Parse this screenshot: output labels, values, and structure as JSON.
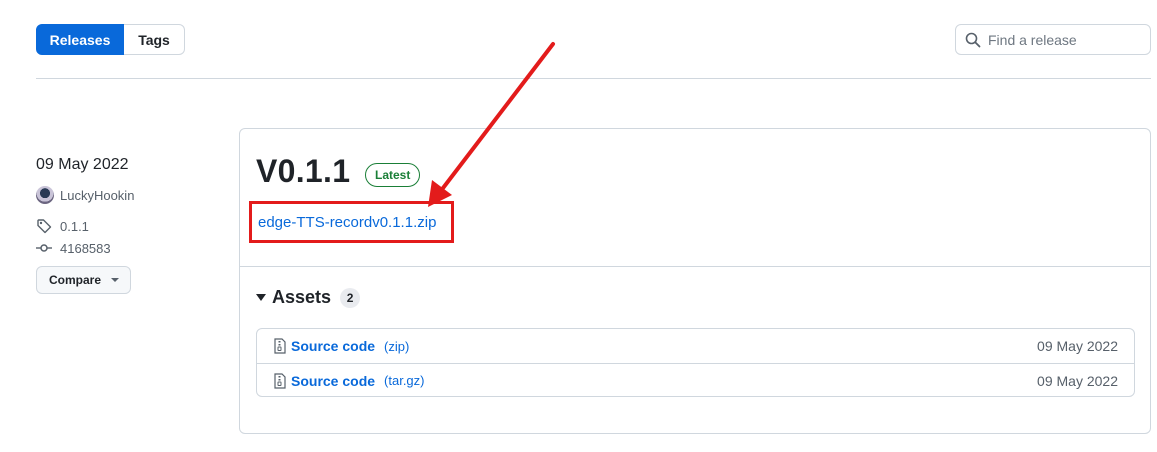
{
  "tabs": [
    {
      "label": "Releases"
    },
    {
      "label": "Tags"
    }
  ],
  "search": {
    "placeholder": "Find a release",
    "icon": "search-icon"
  },
  "meta": {
    "date": "09 May 2022",
    "author": "LuckyHookin",
    "tag": "0.1.1",
    "commit": "4168583",
    "compare_label": "Compare"
  },
  "release": {
    "title": "V0.1.1",
    "badge": "Latest",
    "highlighted_link": "edge-TTS-recordv0.1.1.zip",
    "assets_label": "Assets",
    "assets_count": "2",
    "assets": [
      {
        "name": "Source code",
        "ext": "(zip)",
        "date": "09 May 2022"
      },
      {
        "name": "Source code",
        "ext": "(tar.gz)",
        "date": "09 May 2022"
      }
    ]
  },
  "colors": {
    "accent": "#0969da",
    "latest_green": "#1a7f37",
    "highlight_red": "#e31b1b",
    "border": "#d0d7de"
  }
}
